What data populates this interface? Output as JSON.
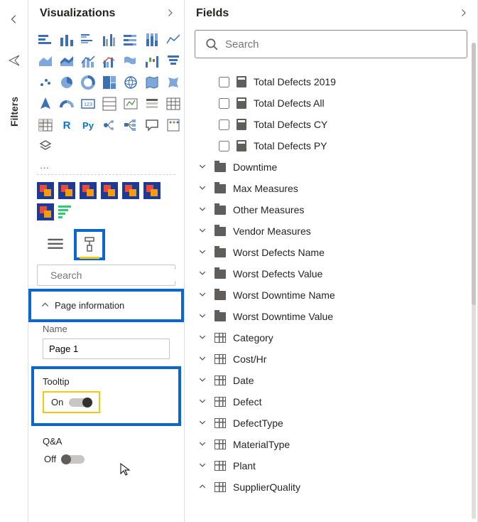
{
  "leftRail": {
    "filtersLabel": "Filters"
  },
  "viz": {
    "title": "Visualizations",
    "ellipsis": "···",
    "search": {
      "placeholder": "Search"
    },
    "pageInfo": {
      "label": "Page information"
    },
    "pageName": {
      "label": "Name",
      "value": "Page 1"
    },
    "tooltip": {
      "label": "Tooltip",
      "state": "On"
    },
    "qa": {
      "label": "Q&A",
      "state": "Off"
    }
  },
  "fields": {
    "title": "Fields",
    "search": {
      "placeholder": "Search"
    },
    "measures": [
      "Total Defects 2019",
      "Total Defects All",
      "Total Defects CY",
      "Total Defects PY"
    ],
    "folders": [
      "Downtime",
      "Max Measures",
      "Other Measures",
      "Vendor Measures",
      "Worst Defects Name",
      "Worst Defects Value",
      "Worst Downtime Name",
      "Worst Downtime Value"
    ],
    "tables": [
      "Category",
      "Cost/Hr",
      "Date",
      "Defect",
      "DefectType",
      "MaterialType",
      "Plant",
      "SupplierQuality"
    ]
  }
}
